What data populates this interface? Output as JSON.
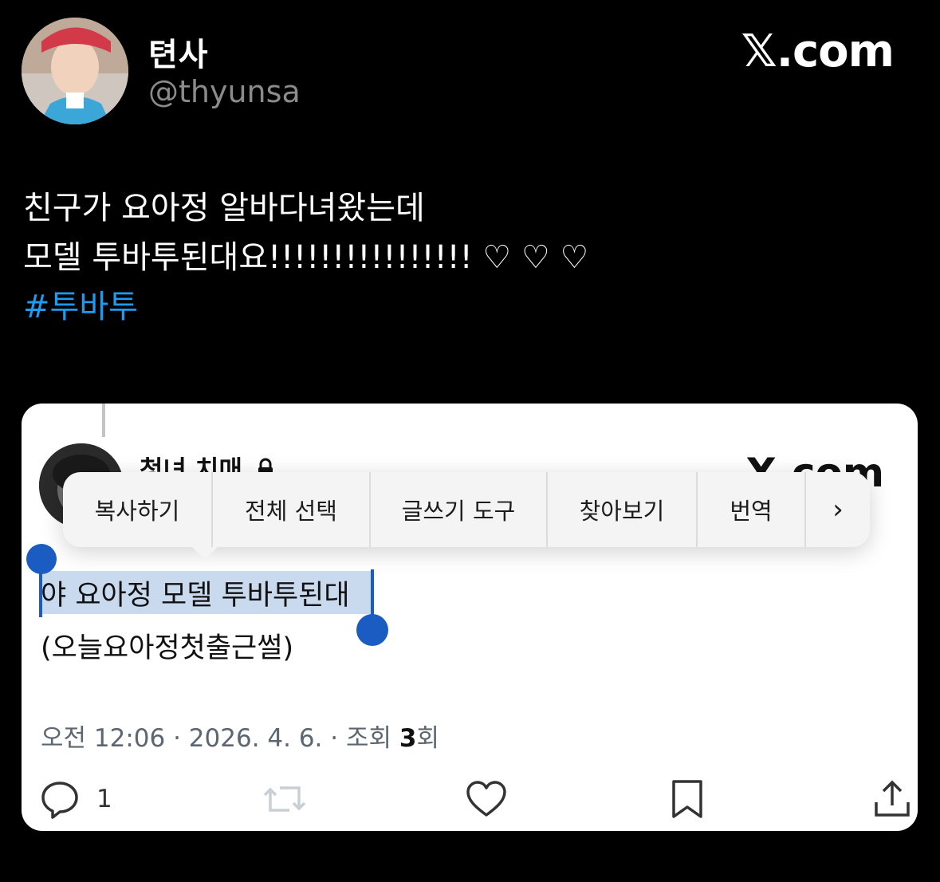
{
  "tweet": {
    "display_name": "텬사",
    "handle": "@thyunsa",
    "brand": "𝕏.com",
    "text_line1": "친구가 요아정 알바다녀왔는데",
    "text_line2": "모델 투바투된대요!!!!!!!!!!!!!!!! ♡ ♡ ♡",
    "hashtag": "#투바투"
  },
  "card": {
    "inner_name": "청녀 치매",
    "inner_brand": "X.com",
    "context_menu": {
      "items": [
        "복사하기",
        "전체 선택",
        "글쓰기 도구",
        "찾아보기",
        "번역",
        "›"
      ]
    },
    "selected_text": "야 요아정 모델 투바투된대",
    "second_line": "(오늘요아정첫출근썰)",
    "meta": {
      "time": "오전 12:06",
      "sep": " · ",
      "date": "2026. 4. 6.",
      "views_prefix": "조회 ",
      "views_count": "3",
      "views_suffix": "회"
    },
    "actions": {
      "reply_count": "1"
    }
  },
  "colors": {
    "hashtag": "#1d9bf0",
    "selection": "#c9d9ee",
    "handle_blue": "#1a5cc2",
    "background": "#000000"
  },
  "icons": [
    "avatar",
    "lock-icon",
    "reply-icon",
    "retweet-icon",
    "like-icon",
    "bookmark-icon",
    "share-icon"
  ]
}
